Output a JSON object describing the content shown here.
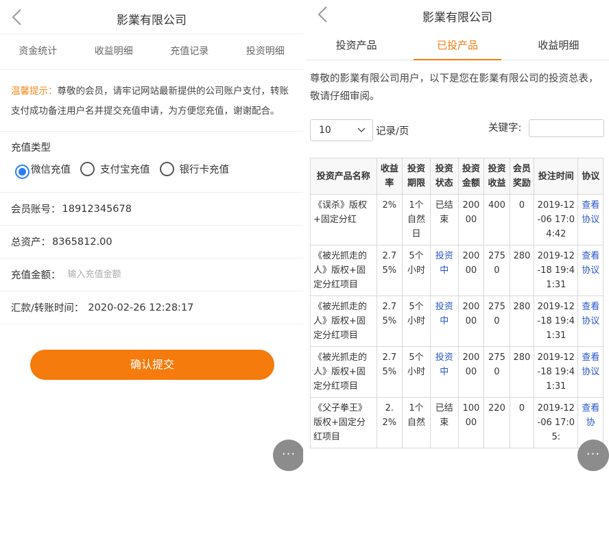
{
  "left": {
    "title": "影業有限公司",
    "tabs": [
      "资金统计",
      "收益明细",
      "充值记录",
      "投资明细"
    ],
    "notice_label": "温馨提示：",
    "notice_text": "尊敬的会员，请牢记网站最新提供的公司账户支付，转账支付成功备注用户名并提交充值申请，为方便您充值，谢谢配合。",
    "charge_type_label": "充值类型",
    "charge_types": [
      "微信充值",
      "支付宝充值",
      "银行卡充值"
    ],
    "account_label": "会员账号：",
    "account_value": "18912345678",
    "assets_label": "总资产：",
    "assets_value": "8365812.00",
    "amount_label": "充值金额：",
    "amount_placeholder": "输入充值金额",
    "time_label": "汇款/转账时间：",
    "time_value": "2020-02-26 12:28:17",
    "submit_label": "确认提交",
    "more_label": "···"
  },
  "right": {
    "title": "影業有限公司",
    "tabs": [
      "投资产品",
      "已投产品",
      "收益明细"
    ],
    "intro": "尊敬的影業有限公司用户，以下是您在影業有限公司的投资总表，敬请仔细审阅。",
    "page_size": "10",
    "per_page_label": "记录/页",
    "keyword_label": "关键字:",
    "more_label": "···",
    "table": {
      "headers": [
        "投资产品名称",
        "收益率",
        "投资期限",
        "投资状态",
        "投资金额",
        "投资收益",
        "会员奖励",
        "投注时间",
        "协议"
      ],
      "rows": [
        [
          "《误杀》版权+固定分红",
          "2%",
          "1个自然日",
          "已结束",
          "20000",
          "400",
          "0",
          "2019-12-06 17:04:42",
          "查看协议"
        ],
        [
          "《被光抓走的人》版权+固定分红项目",
          "2.75%",
          "5个小时",
          "投资中",
          "20000",
          "2750",
          "280",
          "2019-12-18 19:41:31",
          "查看协议"
        ],
        [
          "《被光抓走的人》版权+固定分红项目",
          "2.75%",
          "5个小时",
          "投资中",
          "20000",
          "2750",
          "280",
          "2019-12-18 19:41:31",
          "查看协议"
        ],
        [
          "《被光抓走的人》版权+固定分红项目",
          "2.75%",
          "5个小时",
          "投资中",
          "20000",
          "2750",
          "280",
          "2019-12-18 19:41:31",
          "查看协议"
        ],
        [
          "《父子拳王》版权+固定分红项目",
          "2.2%",
          "1个自然",
          "已结束",
          "10000",
          "220",
          "0",
          "2019-12-06 17:05:",
          "查看协"
        ]
      ]
    }
  },
  "colors": {
    "accent": "#f47b0c",
    "radio_selected": "#2b7cf6",
    "link": "#2a55c8",
    "notice": "#f28a1f"
  }
}
